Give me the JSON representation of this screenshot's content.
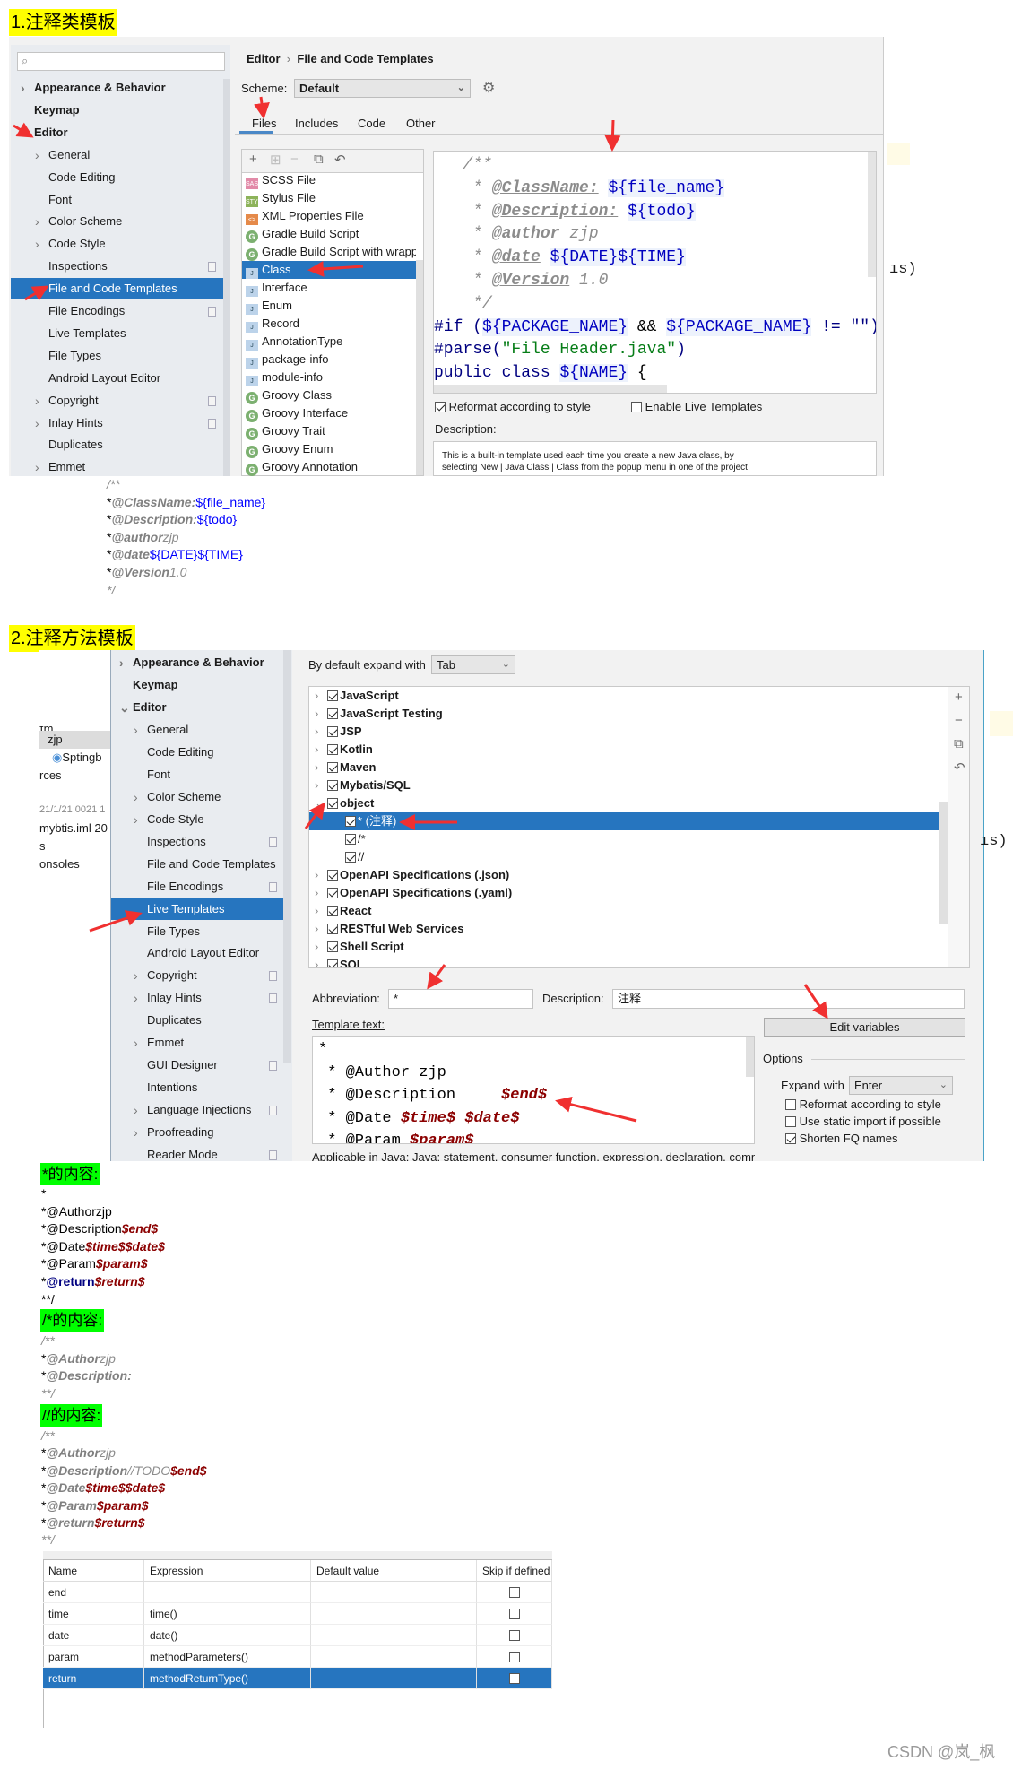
{
  "section1": {
    "label": "1.注释类模板"
  },
  "settings1": {
    "sidebar": [
      {
        "label": "Appearance & Behavior",
        "level": 0,
        "chevron": "right"
      },
      {
        "label": "Keymap",
        "level": 0,
        "chevron": ""
      },
      {
        "label": "Editor",
        "level": 0,
        "chevron": ""
      },
      {
        "label": "General",
        "level": 1,
        "chevron": "right"
      },
      {
        "label": "Code Editing",
        "level": 1,
        "chevron": ""
      },
      {
        "label": "Font",
        "level": 1,
        "chevron": ""
      },
      {
        "label": "Color Scheme",
        "level": 1,
        "chevron": "right"
      },
      {
        "label": "Code Style",
        "level": 1,
        "chevron": "right"
      },
      {
        "label": "Inspections",
        "level": 1,
        "chevron": "",
        "badge": true
      },
      {
        "label": "File and Code Templates",
        "level": 1,
        "chevron": "",
        "selected": true
      },
      {
        "label": "File Encodings",
        "level": 1,
        "chevron": "",
        "badge": true
      },
      {
        "label": "Live Templates",
        "level": 1,
        "chevron": ""
      },
      {
        "label": "File Types",
        "level": 1,
        "chevron": ""
      },
      {
        "label": "Android Layout Editor",
        "level": 1,
        "chevron": ""
      },
      {
        "label": "Copyright",
        "level": 1,
        "chevron": "right",
        "badge": true
      },
      {
        "label": "Inlay Hints",
        "level": 1,
        "chevron": "right",
        "badge": true
      },
      {
        "label": "Duplicates",
        "level": 1,
        "chevron": ""
      },
      {
        "label": "Emmet",
        "level": 1,
        "chevron": "right"
      }
    ],
    "breadcrumb": {
      "parent": "Editor",
      "separator": "›",
      "current": "File and Code Templates"
    },
    "scheme": {
      "label": "Scheme:",
      "value": "Default"
    },
    "tabs": [
      "Files",
      "Includes",
      "Code",
      "Other"
    ],
    "active_tab": "Files",
    "toolbar": {
      "add": "+",
      "remove": "−"
    },
    "templates": [
      {
        "label": "SCSS File",
        "icon": "sass",
        "glyph": "SASS"
      },
      {
        "label": "Stylus File",
        "icon": "styl",
        "glyph": "STYL"
      },
      {
        "label": "XML Properties File",
        "icon": "xml",
        "glyph": "<>"
      },
      {
        "label": "Gradle Build Script",
        "icon": "g",
        "glyph": "G"
      },
      {
        "label": "Gradle Build Script with wrapper",
        "icon": "g",
        "glyph": "G"
      },
      {
        "label": "Class",
        "icon": "java",
        "glyph": "J",
        "selected": true
      },
      {
        "label": "Interface",
        "icon": "java",
        "glyph": "J"
      },
      {
        "label": "Enum",
        "icon": "java",
        "glyph": "J"
      },
      {
        "label": "Record",
        "icon": "java",
        "glyph": "J"
      },
      {
        "label": "AnnotationType",
        "icon": "java",
        "glyph": "J"
      },
      {
        "label": "package-info",
        "icon": "java",
        "glyph": "J"
      },
      {
        "label": "module-info",
        "icon": "java",
        "glyph": "J"
      },
      {
        "label": "Groovy Class",
        "icon": "g",
        "glyph": "G"
      },
      {
        "label": "Groovy Interface",
        "icon": "g",
        "glyph": "G"
      },
      {
        "label": "Groovy Trait",
        "icon": "g",
        "glyph": "G"
      },
      {
        "label": "Groovy Enum",
        "icon": "g",
        "glyph": "G"
      },
      {
        "label": "Groovy Annotation",
        "icon": "g",
        "glyph": "G"
      }
    ],
    "editor_lines": [
      [
        {
          "t": "   /**",
          "s": "c"
        }
      ],
      [
        {
          "t": "    * ",
          "s": "c"
        },
        {
          "t": "@ClassName:",
          "s": "tagu"
        },
        {
          "t": " ",
          "s": "c"
        },
        {
          "t": "${file_name}",
          "s": "v"
        }
      ],
      [
        {
          "t": "    * ",
          "s": "c"
        },
        {
          "t": "@Description:",
          "s": "tagu"
        },
        {
          "t": " ",
          "s": "c"
        },
        {
          "t": "${todo}",
          "s": "v"
        }
      ],
      [
        {
          "t": "    * ",
          "s": "c"
        },
        {
          "t": "@author",
          "s": "tagu"
        },
        {
          "t": " zjp",
          "s": "c"
        }
      ],
      [
        {
          "t": "    * ",
          "s": "c"
        },
        {
          "t": "@date",
          "s": "tagu"
        },
        {
          "t": " ",
          "s": "c"
        },
        {
          "t": "${DATE}${TIME}",
          "s": "v"
        }
      ],
      [
        {
          "t": "    * ",
          "s": "c"
        },
        {
          "t": "@Version",
          "s": "tagu"
        },
        {
          "t": " 1.0",
          "s": "c"
        }
      ],
      [
        {
          "t": "    */",
          "s": "c"
        }
      ],
      [
        {
          "t": "#if (",
          "s": "k"
        },
        {
          "t": "${PACKAGE_NAME}",
          "s": "v"
        },
        {
          "t": " && ",
          "s": "p"
        },
        {
          "t": "${PACKAGE_NAME}",
          "s": "v"
        },
        {
          "t": " != \"\")package",
          "s": "k"
        }
      ],
      [
        {
          "t": "#parse(",
          "s": "k"
        },
        {
          "t": "\"File Header.java\"",
          "s": "str"
        },
        {
          "t": ")",
          "s": "k"
        }
      ],
      [
        {
          "t": "public class ",
          "s": "k"
        },
        {
          "t": "${NAME}",
          "s": "v"
        },
        {
          "t": " {",
          "s": "p"
        }
      ]
    ],
    "reformat": {
      "label": "Reformat according to style",
      "checked": true
    },
    "enable_live": {
      "label": "Enable Live Templates",
      "checked": false
    },
    "description_label": "Description:",
    "description_lines": [
      "This is a built-in template used each time you create a new Java class, by",
      "selecting New | Java Class | Class from the popup menu in one of the project"
    ],
    "background_fragment": "ıs)"
  },
  "comment1": [
    [
      {
        "t": "/**",
        "s": "ci"
      }
    ],
    [
      {
        "t": "*",
        "s": "p"
      },
      {
        "t": "@ClassName:",
        "s": "tag"
      },
      {
        "t": "${file_name}",
        "s": "vb"
      }
    ],
    [
      {
        "t": "*",
        "s": "p"
      },
      {
        "t": "@Description:",
        "s": "tag"
      },
      {
        "t": "${todo}",
        "s": "vb"
      }
    ],
    [
      {
        "t": "*",
        "s": "p"
      },
      {
        "t": "@author",
        "s": "tag"
      },
      {
        "t": "zjp",
        "s": "ci"
      }
    ],
    [
      {
        "t": "*",
        "s": "p"
      },
      {
        "t": "@date",
        "s": "tag"
      },
      {
        "t": "${DATE}${TIME}",
        "s": "vb"
      }
    ],
    [
      {
        "t": "*",
        "s": "p"
      },
      {
        "t": "@Version",
        "s": "tag"
      },
      {
        "t": "1.0",
        "s": "ci"
      }
    ],
    [
      {
        "t": "*/",
        "s": "ci"
      }
    ]
  ],
  "section2": {
    "label": "2.注释方法模板"
  },
  "settings2": {
    "project_fragment": [
      "ɪm",
      "zjp",
      "Sptingb",
      "rces",
      "21/1/21 0021 1",
      "mybtis.iml  20",
      "s",
      "onsoles"
    ],
    "sidebar": [
      {
        "label": "Appearance & Behavior",
        "level": 0,
        "chevron": "right"
      },
      {
        "label": "Keymap",
        "level": 0,
        "chevron": ""
      },
      {
        "label": "Editor",
        "level": 0,
        "chevron": "down"
      },
      {
        "label": "General",
        "level": 1,
        "chevron": "right"
      },
      {
        "label": "Code Editing",
        "level": 1,
        "chevron": ""
      },
      {
        "label": "Font",
        "level": 1,
        "chevron": ""
      },
      {
        "label": "Color Scheme",
        "level": 1,
        "chevron": "right"
      },
      {
        "label": "Code Style",
        "level": 1,
        "chevron": "right"
      },
      {
        "label": "Inspections",
        "level": 1,
        "chevron": "",
        "badge": true
      },
      {
        "label": "File and Code Templates",
        "level": 1,
        "chevron": ""
      },
      {
        "label": "File Encodings",
        "level": 1,
        "chevron": "",
        "badge": true
      },
      {
        "label": "Live Templates",
        "level": 1,
        "chevron": "",
        "selected": true
      },
      {
        "label": "File Types",
        "level": 1,
        "chevron": ""
      },
      {
        "label": "Android Layout Editor",
        "level": 1,
        "chevron": ""
      },
      {
        "label": "Copyright",
        "level": 1,
        "chevron": "right",
        "badge": true
      },
      {
        "label": "Inlay Hints",
        "level": 1,
        "chevron": "right",
        "badge": true
      },
      {
        "label": "Duplicates",
        "level": 1,
        "chevron": ""
      },
      {
        "label": "Emmet",
        "level": 1,
        "chevron": "right"
      },
      {
        "label": "GUI Designer",
        "level": 1,
        "chevron": "",
        "badge": true
      },
      {
        "label": "Intentions",
        "level": 1,
        "chevron": ""
      },
      {
        "label": "Language Injections",
        "level": 1,
        "chevron": "right",
        "badge": true
      },
      {
        "label": "Proofreading",
        "level": 1,
        "chevron": "right"
      },
      {
        "label": "Reader Mode",
        "level": 1,
        "chevron": "",
        "badge": true
      }
    ],
    "expand_label": "By default expand with",
    "expand_value": "Tab",
    "tree": [
      {
        "label": "JavaScript",
        "level": 0,
        "chevron": "right",
        "checked": true
      },
      {
        "label": "JavaScript Testing",
        "level": 0,
        "chevron": "right",
        "checked": true
      },
      {
        "label": "JSP",
        "level": 0,
        "chevron": "right",
        "checked": true
      },
      {
        "label": "Kotlin",
        "level": 0,
        "chevron": "right",
        "checked": true
      },
      {
        "label": "Maven",
        "level": 0,
        "chevron": "right",
        "checked": true
      },
      {
        "label": "Mybatis/SQL",
        "level": 0,
        "chevron": "right",
        "checked": true
      },
      {
        "label": "object",
        "level": 0,
        "chevron": "down",
        "checked": true
      },
      {
        "label": "* (注释)",
        "level": 1,
        "checked": true,
        "selected": true
      },
      {
        "label": "/*",
        "level": 1,
        "checked": true
      },
      {
        "label": "//",
        "level": 1,
        "checked": true
      },
      {
        "label": "OpenAPI Specifications (.json)",
        "level": 0,
        "chevron": "right",
        "checked": true
      },
      {
        "label": "OpenAPI Specifications (.yaml)",
        "level": 0,
        "chevron": "right",
        "checked": true
      },
      {
        "label": "React",
        "level": 0,
        "chevron": "right",
        "checked": true
      },
      {
        "label": "RESTful Web Services",
        "level": 0,
        "chevron": "right",
        "checked": true
      },
      {
        "label": "Shell Script",
        "level": 0,
        "chevron": "right",
        "checked": true
      },
      {
        "label": "SQL",
        "level": 0,
        "chevron": "right",
        "checked": true
      }
    ],
    "tree_tools": {
      "add": "+",
      "remove": "−",
      "copy": "⧉",
      "restore": "↶"
    },
    "abbreviation_label": "Abbreviation:",
    "abbreviation": "*",
    "description_label": "Description:",
    "description": "注释",
    "template_text_label": "Template text:",
    "edit_variables": "Edit variables",
    "template_lines": [
      [
        {
          "t": "*",
          "s": "p"
        }
      ],
      [
        {
          "t": " * @Author zjp",
          "s": "p"
        }
      ],
      [
        {
          "t": " * @Description     ",
          "s": "p"
        },
        {
          "t": "$end$",
          "s": "r"
        }
      ],
      [
        {
          "t": " * @Date ",
          "s": "p"
        },
        {
          "t": "$time$",
          "s": "r"
        },
        {
          "t": " ",
          "s": "p"
        },
        {
          "t": "$date$",
          "s": "r"
        }
      ],
      [
        {
          "t": " * @Param ",
          "s": "p"
        },
        {
          "t": "$param$",
          "s": "r"
        }
      ]
    ],
    "options_label": "Options",
    "expand_with_label": "Expand with",
    "expand_with_value": "Enter",
    "options": [
      {
        "label": "Reformat according to style",
        "checked": false
      },
      {
        "label": "Use static import if possible",
        "checked": false
      },
      {
        "label": "Shorten FQ names",
        "checked": true
      }
    ],
    "applicable": "Applicable in Java: Java: statement, consumer function, expression, declaration, comm",
    "background_fragment": "ıs)"
  },
  "block_star": {
    "label": "*的内容:",
    "lines": [
      [
        {
          "t": "*",
          "s": "p"
        }
      ],
      [
        {
          "t": "*@Authorzjp",
          "s": "p"
        }
      ],
      [
        {
          "t": "*@Description",
          "s": "p"
        },
        {
          "t": "$end$",
          "s": "r"
        }
      ],
      [
        {
          "t": "*@Date",
          "s": "p"
        },
        {
          "t": "$time$$date$",
          "s": "r"
        }
      ],
      [
        {
          "t": "*@Param",
          "s": "p"
        },
        {
          "t": "$param$",
          "s": "r"
        }
      ],
      [
        {
          "t": "*",
          "s": "p"
        },
        {
          "t": "@return",
          "s": "kb"
        },
        {
          "t": "$return$",
          "s": "r"
        }
      ],
      [
        {
          "t": "**/",
          "s": "p"
        }
      ]
    ]
  },
  "block_slashstar": {
    "label": "/*的内容:",
    "lines": [
      [
        {
          "t": "/**",
          "s": "ci"
        }
      ],
      [
        {
          "t": "*",
          "s": "p"
        },
        {
          "t": "@Author",
          "s": "tag"
        },
        {
          "t": "zjp",
          "s": "ci"
        }
      ],
      [
        {
          "t": "*",
          "s": "p"
        },
        {
          "t": "@Description:",
          "s": "tag"
        }
      ],
      [
        {
          "t": "**/",
          "s": "ci"
        }
      ]
    ]
  },
  "block_slashslash": {
    "label": "//的内容:",
    "lines": [
      [
        {
          "t": "/**",
          "s": "ci"
        }
      ],
      [
        {
          "t": "*",
          "s": "p"
        },
        {
          "t": "@Author",
          "s": "tag"
        },
        {
          "t": "zjp",
          "s": "ci"
        }
      ],
      [
        {
          "t": "*",
          "s": "p"
        },
        {
          "t": "@Description",
          "s": "tag"
        },
        {
          "t": "//TODO",
          "s": "ci"
        },
        {
          "t": "$end$",
          "s": "r"
        }
      ],
      [
        {
          "t": "*",
          "s": "p"
        },
        {
          "t": "@Date",
          "s": "tag"
        },
        {
          "t": "$time$$date$",
          "s": "r"
        }
      ],
      [
        {
          "t": "*",
          "s": "p"
        },
        {
          "t": "@Param",
          "s": "tag"
        },
        {
          "t": "$param$",
          "s": "r"
        }
      ],
      [
        {
          "t": "*",
          "s": "p"
        },
        {
          "t": "@return",
          "s": "tag"
        },
        {
          "t": "$return$",
          "s": "r"
        }
      ],
      [
        {
          "t": "**/",
          "s": "ci"
        }
      ]
    ]
  },
  "variables_table": {
    "headers": [
      "Name",
      "Expression",
      "Default value",
      "Skip if defined"
    ],
    "rows": [
      {
        "name": "end",
        "expression": "",
        "default": "",
        "skip": false
      },
      {
        "name": "time",
        "expression": "time()",
        "default": "",
        "skip": false
      },
      {
        "name": "date",
        "expression": "date()",
        "default": "",
        "skip": false
      },
      {
        "name": "param",
        "expression": "methodParameters()",
        "default": "",
        "skip": false
      },
      {
        "name": "return",
        "expression": "methodReturnType()",
        "default": "",
        "skip": false,
        "selected": true
      }
    ]
  },
  "watermark": "CSDN @岚_枫",
  "colors": {
    "selection": "#2675bf",
    "sidebar_bg": "#e9ecf0",
    "label_yellow": "#ffff00",
    "label_green": "#00ff00",
    "template_var": "#8b0000"
  }
}
